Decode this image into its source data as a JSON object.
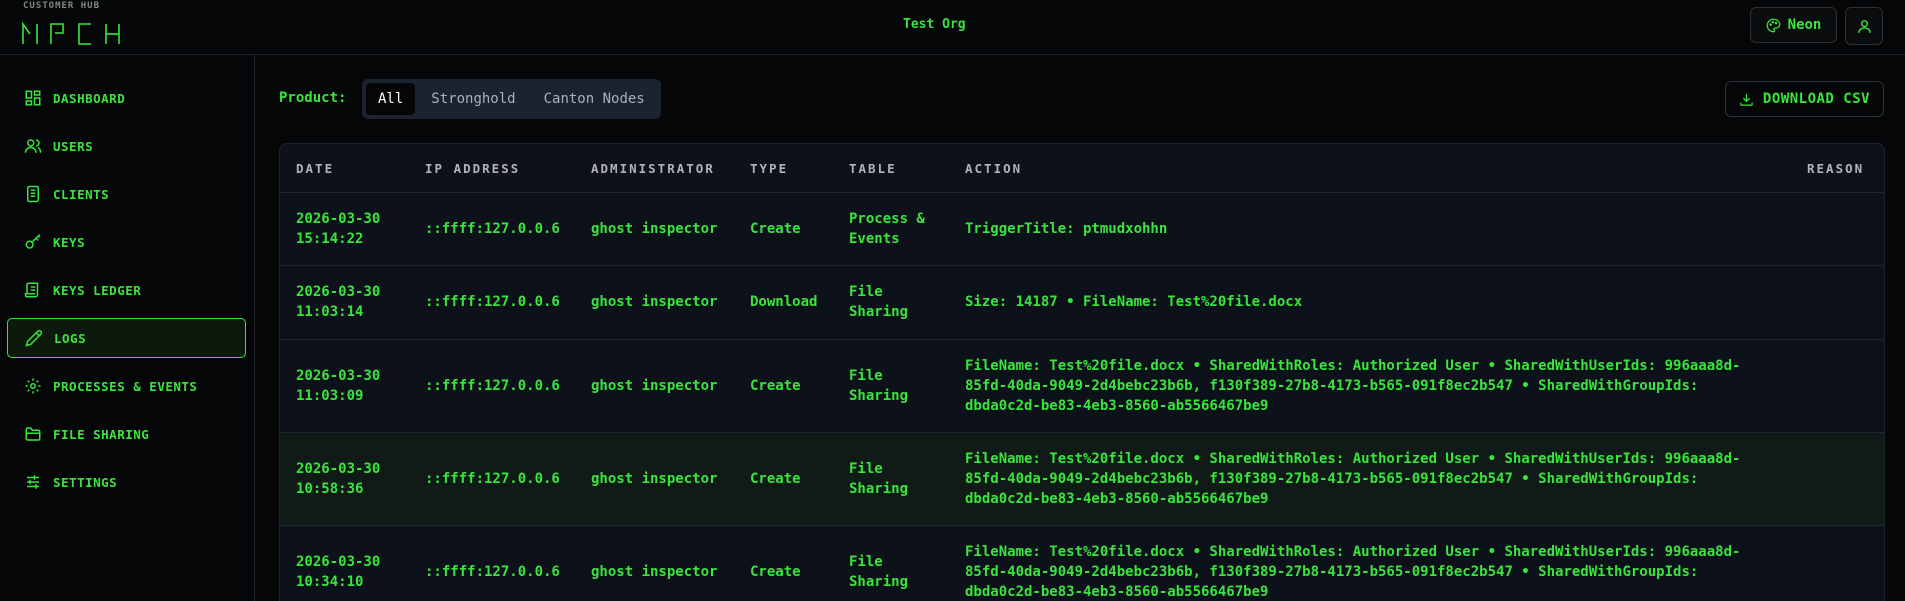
{
  "header": {
    "hub_label": "CUSTOMER HUB",
    "logo_text": "MPCH",
    "org": "Test Org",
    "theme_label": "Neon"
  },
  "sidebar": {
    "items": [
      {
        "label": "DASHBOARD",
        "icon": "dashboard-icon"
      },
      {
        "label": "USERS",
        "icon": "users-icon"
      },
      {
        "label": "CLIENTS",
        "icon": "clients-icon"
      },
      {
        "label": "KEYS",
        "icon": "key-icon"
      },
      {
        "label": "KEYS LEDGER",
        "icon": "ledger-icon"
      },
      {
        "label": "LOGS",
        "icon": "pencil-icon",
        "active": true
      },
      {
        "label": "PROCESSES & EVENTS",
        "icon": "gear-icon"
      },
      {
        "label": "FILE SHARING",
        "icon": "folder-icon"
      },
      {
        "label": "SETTINGS",
        "icon": "sliders-icon"
      }
    ]
  },
  "main": {
    "product_label": "Product:",
    "filters": [
      "All",
      "Stronghold",
      "Canton Nodes"
    ],
    "selected_filter": "All",
    "download_label": "DOWNLOAD CSV"
  },
  "table": {
    "columns": [
      "DATE",
      "IP ADDRESS",
      "ADMINISTRATOR",
      "TYPE",
      "TABLE",
      "ACTION",
      "REASON"
    ],
    "rows": [
      {
        "date": "2026-03-30 15:14:22",
        "ip": "::ffff:127.0.0.6",
        "admin": "ghost inspector",
        "type": "Create",
        "table": "Process & Events",
        "action": "TriggerTitle: ptmudxohhn",
        "reason": ""
      },
      {
        "date": "2026-03-30 11:03:14",
        "ip": "::ffff:127.0.0.6",
        "admin": "ghost inspector",
        "type": "Download",
        "table": "File Sharing",
        "action": "Size: 14187 • FileName: Test%20file.docx",
        "reason": ""
      },
      {
        "date": "2026-03-30 11:03:09",
        "ip": "::ffff:127.0.0.6",
        "admin": "ghost inspector",
        "type": "Create",
        "table": "File Sharing",
        "action": "FileName: Test%20file.docx • SharedWithRoles: Authorized User • SharedWithUserIds: 996aaa8d-85fd-40da-9049-2d4bebc23b6b, f130f389-27b8-4173-b565-091f8ec2b547 • SharedWithGroupIds: dbda0c2d-be83-4eb3-8560-ab5566467be9",
        "reason": ""
      },
      {
        "date": "2026-03-30 10:58:36",
        "ip": "::ffff:127.0.0.6",
        "admin": "ghost inspector",
        "type": "Create",
        "table": "File Sharing",
        "action": "FileName: Test%20file.docx • SharedWithRoles: Authorized User • SharedWithUserIds: 996aaa8d-85fd-40da-9049-2d4bebc23b6b, f130f389-27b8-4173-b565-091f8ec2b547 • SharedWithGroupIds: dbda0c2d-be83-4eb3-8560-ab5566467be9",
        "reason": ""
      },
      {
        "date": "2026-03-30 10:34:10",
        "ip": "::ffff:127.0.0.6",
        "admin": "ghost inspector",
        "type": "Create",
        "table": "File Sharing",
        "action": "FileName: Test%20file.docx • SharedWithRoles: Authorized User • SharedWithUserIds: 996aaa8d-85fd-40da-9049-2d4bebc23b6b, f130f389-27b8-4173-b565-091f8ec2b547 • SharedWithGroupIds: dbda0c2d-be83-4eb3-8560-ab5566467be9",
        "reason": ""
      }
    ]
  },
  "colors": {
    "accent": "#39e53c",
    "background": "#050607",
    "table_bg": "#0d111a"
  }
}
